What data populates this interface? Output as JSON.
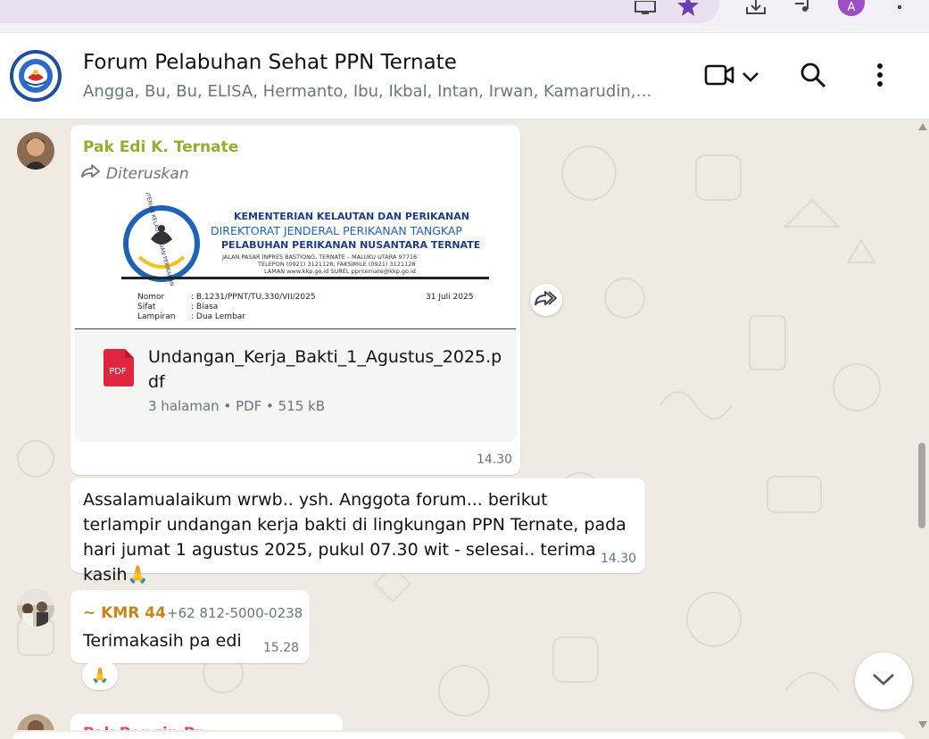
{
  "group": {
    "title": "Forum Pelabuhan Sehat PPN Ternate",
    "members": "Angga, Bu, Bu, ELISA, Hermanto, Ibu, Ikbal, Intan, Irwan, Kamarudin, Mb..."
  },
  "messages": [
    {
      "sender": "Pak Edi K. Ternate",
      "sender_color": "#9aab2d",
      "forwarded_label": "Diteruskan",
      "document": {
        "letterhead": {
          "line1": "KEMENTERIAN KELAUTAN DAN PERIKANAN",
          "line2": "DIREKTORAT JENDERAL PERIKANAN TANGKAP",
          "line3": "PELABUHAN PERIKANAN NUSANTARA TERNATE",
          "address": "JALAN PASAR INPRES BASTIONG, TERNATE – MALUKU UTARA 97716",
          "phone": "TELEPON (0921) 3121128; FAKSIMILE (0921) 3121128",
          "web": "LAMAN www.kkp.go.id  SUREL ppnternate@kkp.go.id",
          "seal_text": "KEMENTERIAN KELAUTAN DAN PERIKANAN"
        },
        "fields": [
          {
            "label": "Nomor",
            "value": ": B.1231/PPNT/TU.330/VII/2025"
          },
          {
            "label": "Sifat",
            "value": ": Biasa"
          },
          {
            "label": "Lampiran",
            "value": ": Dua Lembar"
          }
        ],
        "date": "31 Juli 2025",
        "filename": "Undangan_Kerja_Bakti_1_Agustus_2025.pdf",
        "meta": "3 halaman • PDF • 515 kB",
        "icon_label": "PDF"
      },
      "time": "14.30"
    },
    {
      "text": "Assalamualaikum wrwb.. ysh. Anggota forum... berikut terlampir undangan kerja bakti di lingkungan PPN Ternate, pada hari jumat 1 agustus 2025, pukul 07.30 wit - selesai.. terima kasih🙏",
      "time": "14.30"
    },
    {
      "sender": "~ KMR 44",
      "sender_color": "#c8841c",
      "phone": "+62 812-5000-0238",
      "text": "Terimakasih pa edi",
      "time": "15.28",
      "reaction": "🙏"
    },
    {
      "sender": "Pak Pengin Pr...",
      "sender_color": "#e0487a"
    }
  ],
  "icons": {
    "video_call": "video-camera-icon",
    "dropdown": "chevron-down-icon",
    "search": "search-icon",
    "menu": "more-vertical-icon",
    "forward": "forward-icon",
    "pdf": "pdf-file-icon",
    "scroll_down": "chevron-down-icon"
  },
  "browser": {
    "profile_initial": "A"
  }
}
